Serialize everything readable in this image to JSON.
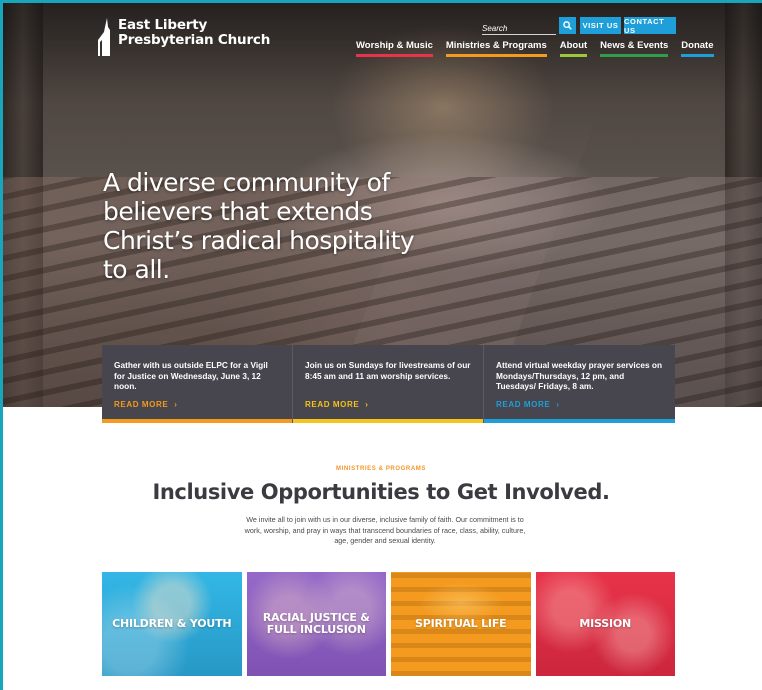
{
  "header": {
    "logo_line1": "East Liberty",
    "logo_line2": "Presbyterian Church",
    "search_placeholder": "Search",
    "visit_label": "VISIT US",
    "contact_label": "CONTACT US"
  },
  "nav": {
    "items": [
      {
        "label": "Worship & Music",
        "color": "#e8334a"
      },
      {
        "label": "Ministries & Programs",
        "color": "#f39a1f"
      },
      {
        "label": "About",
        "color": "#9dc73b"
      },
      {
        "label": "News & Events",
        "color": "#2e9e4a"
      },
      {
        "label": "Donate",
        "color": "#1e9fd9"
      }
    ]
  },
  "hero": {
    "headline": "A diverse community of believers that extends Christ’s radical hospitality to all."
  },
  "cards": [
    {
      "text": "Gather with us outside ELPC for a Vigil for Justice on Wednesday, June 3, 12 noon.",
      "more": "READ MORE",
      "accent": "#f39a1f"
    },
    {
      "text": "Join us on Sundays for livestreams of our 8:45 am and 11 am worship services.",
      "more": "READ MORE",
      "accent": "#f6c21c"
    },
    {
      "text": "Attend virtual weekday prayer services on Mondays/Thursdays, 12 pm, and Tuesdays/ Fridays, 8 am.",
      "more": "READ MORE",
      "accent": "#1e9fd9"
    }
  ],
  "section": {
    "eyebrow": "MINISTRIES & PROGRAMS",
    "title": "Inclusive Opportunities to Get Involved.",
    "intro": "We invite all to join with us in our diverse, inclusive family of faith. Our commitment is to work, worship, and pray in ways that transcend boundaries of race, class, ability, culture, age, gender and sexual identity."
  },
  "tiles": [
    {
      "label": "CHILDREN & YOUTH"
    },
    {
      "label": "RACIAL JUSTICE & FULL INCLUSION"
    },
    {
      "label": "SPIRITUAL LIFE"
    },
    {
      "label": "MISSION"
    }
  ],
  "colors": {
    "accent_blue": "#1e9fd9",
    "card_bg": "#47454d",
    "eyebrow_orange": "#f2952a"
  }
}
